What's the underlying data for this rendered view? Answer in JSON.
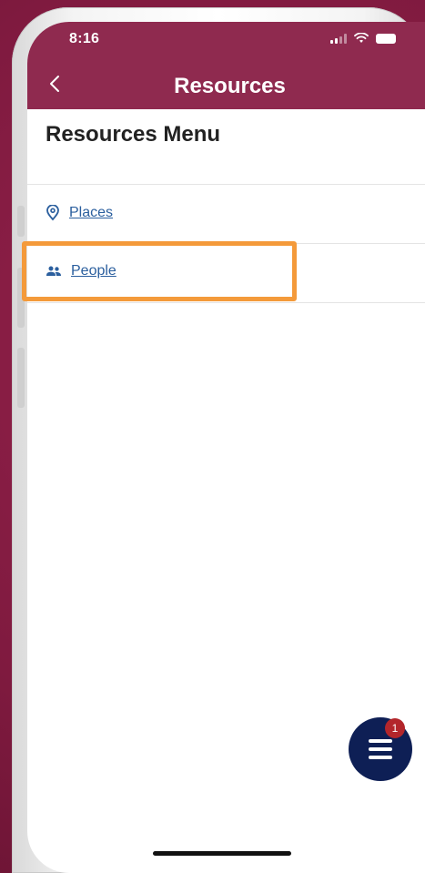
{
  "status_bar": {
    "time": "8:16"
  },
  "header": {
    "back_icon": "chevron-left-icon",
    "title": "Resources"
  },
  "content": {
    "heading": "Resources Menu",
    "items": [
      {
        "label": "Places",
        "icon": "location-pin-icon"
      },
      {
        "label": "People",
        "icon": "people-icon"
      }
    ]
  },
  "fab": {
    "icon": "hamburger-menu-icon",
    "badge_count": "1"
  },
  "colors": {
    "header": "#8f2a4f",
    "link": "#2b5f9e",
    "highlight": "#f49a3a",
    "fab": "#0e1f55",
    "badge": "#b3262b"
  }
}
